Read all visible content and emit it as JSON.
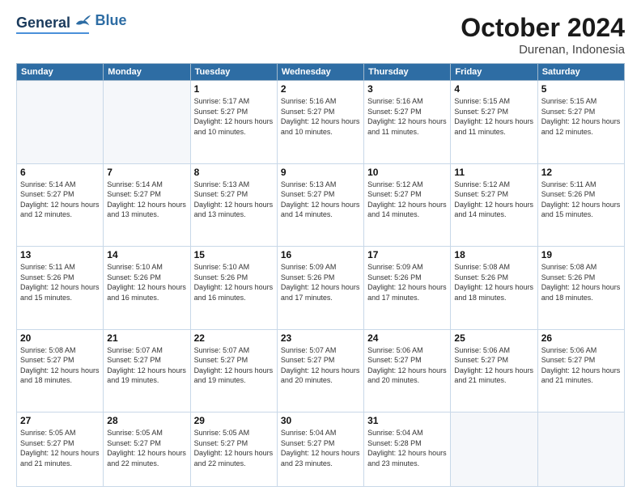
{
  "header": {
    "logo_general": "General",
    "logo_blue": "Blue",
    "month": "October 2024",
    "location": "Durenan, Indonesia"
  },
  "days_of_week": [
    "Sunday",
    "Monday",
    "Tuesday",
    "Wednesday",
    "Thursday",
    "Friday",
    "Saturday"
  ],
  "weeks": [
    [
      {
        "day": "",
        "sunrise": "",
        "sunset": "",
        "daylight": "",
        "empty": true
      },
      {
        "day": "",
        "sunrise": "",
        "sunset": "",
        "daylight": "",
        "empty": true
      },
      {
        "day": "1",
        "sunrise": "Sunrise: 5:17 AM",
        "sunset": "Sunset: 5:27 PM",
        "daylight": "Daylight: 12 hours and 10 minutes."
      },
      {
        "day": "2",
        "sunrise": "Sunrise: 5:16 AM",
        "sunset": "Sunset: 5:27 PM",
        "daylight": "Daylight: 12 hours and 10 minutes."
      },
      {
        "day": "3",
        "sunrise": "Sunrise: 5:16 AM",
        "sunset": "Sunset: 5:27 PM",
        "daylight": "Daylight: 12 hours and 11 minutes."
      },
      {
        "day": "4",
        "sunrise": "Sunrise: 5:15 AM",
        "sunset": "Sunset: 5:27 PM",
        "daylight": "Daylight: 12 hours and 11 minutes."
      },
      {
        "day": "5",
        "sunrise": "Sunrise: 5:15 AM",
        "sunset": "Sunset: 5:27 PM",
        "daylight": "Daylight: 12 hours and 12 minutes."
      }
    ],
    [
      {
        "day": "6",
        "sunrise": "Sunrise: 5:14 AM",
        "sunset": "Sunset: 5:27 PM",
        "daylight": "Daylight: 12 hours and 12 minutes."
      },
      {
        "day": "7",
        "sunrise": "Sunrise: 5:14 AM",
        "sunset": "Sunset: 5:27 PM",
        "daylight": "Daylight: 12 hours and 13 minutes."
      },
      {
        "day": "8",
        "sunrise": "Sunrise: 5:13 AM",
        "sunset": "Sunset: 5:27 PM",
        "daylight": "Daylight: 12 hours and 13 minutes."
      },
      {
        "day": "9",
        "sunrise": "Sunrise: 5:13 AM",
        "sunset": "Sunset: 5:27 PM",
        "daylight": "Daylight: 12 hours and 14 minutes."
      },
      {
        "day": "10",
        "sunrise": "Sunrise: 5:12 AM",
        "sunset": "Sunset: 5:27 PM",
        "daylight": "Daylight: 12 hours and 14 minutes."
      },
      {
        "day": "11",
        "sunrise": "Sunrise: 5:12 AM",
        "sunset": "Sunset: 5:27 PM",
        "daylight": "Daylight: 12 hours and 14 minutes."
      },
      {
        "day": "12",
        "sunrise": "Sunrise: 5:11 AM",
        "sunset": "Sunset: 5:26 PM",
        "daylight": "Daylight: 12 hours and 15 minutes."
      }
    ],
    [
      {
        "day": "13",
        "sunrise": "Sunrise: 5:11 AM",
        "sunset": "Sunset: 5:26 PM",
        "daylight": "Daylight: 12 hours and 15 minutes."
      },
      {
        "day": "14",
        "sunrise": "Sunrise: 5:10 AM",
        "sunset": "Sunset: 5:26 PM",
        "daylight": "Daylight: 12 hours and 16 minutes."
      },
      {
        "day": "15",
        "sunrise": "Sunrise: 5:10 AM",
        "sunset": "Sunset: 5:26 PM",
        "daylight": "Daylight: 12 hours and 16 minutes."
      },
      {
        "day": "16",
        "sunrise": "Sunrise: 5:09 AM",
        "sunset": "Sunset: 5:26 PM",
        "daylight": "Daylight: 12 hours and 17 minutes."
      },
      {
        "day": "17",
        "sunrise": "Sunrise: 5:09 AM",
        "sunset": "Sunset: 5:26 PM",
        "daylight": "Daylight: 12 hours and 17 minutes."
      },
      {
        "day": "18",
        "sunrise": "Sunrise: 5:08 AM",
        "sunset": "Sunset: 5:26 PM",
        "daylight": "Daylight: 12 hours and 18 minutes."
      },
      {
        "day": "19",
        "sunrise": "Sunrise: 5:08 AM",
        "sunset": "Sunset: 5:26 PM",
        "daylight": "Daylight: 12 hours and 18 minutes."
      }
    ],
    [
      {
        "day": "20",
        "sunrise": "Sunrise: 5:08 AM",
        "sunset": "Sunset: 5:27 PM",
        "daylight": "Daylight: 12 hours and 18 minutes."
      },
      {
        "day": "21",
        "sunrise": "Sunrise: 5:07 AM",
        "sunset": "Sunset: 5:27 PM",
        "daylight": "Daylight: 12 hours and 19 minutes."
      },
      {
        "day": "22",
        "sunrise": "Sunrise: 5:07 AM",
        "sunset": "Sunset: 5:27 PM",
        "daylight": "Daylight: 12 hours and 19 minutes."
      },
      {
        "day": "23",
        "sunrise": "Sunrise: 5:07 AM",
        "sunset": "Sunset: 5:27 PM",
        "daylight": "Daylight: 12 hours and 20 minutes."
      },
      {
        "day": "24",
        "sunrise": "Sunrise: 5:06 AM",
        "sunset": "Sunset: 5:27 PM",
        "daylight": "Daylight: 12 hours and 20 minutes."
      },
      {
        "day": "25",
        "sunrise": "Sunrise: 5:06 AM",
        "sunset": "Sunset: 5:27 PM",
        "daylight": "Daylight: 12 hours and 21 minutes."
      },
      {
        "day": "26",
        "sunrise": "Sunrise: 5:06 AM",
        "sunset": "Sunset: 5:27 PM",
        "daylight": "Daylight: 12 hours and 21 minutes."
      }
    ],
    [
      {
        "day": "27",
        "sunrise": "Sunrise: 5:05 AM",
        "sunset": "Sunset: 5:27 PM",
        "daylight": "Daylight: 12 hours and 21 minutes."
      },
      {
        "day": "28",
        "sunrise": "Sunrise: 5:05 AM",
        "sunset": "Sunset: 5:27 PM",
        "daylight": "Daylight: 12 hours and 22 minutes."
      },
      {
        "day": "29",
        "sunrise": "Sunrise: 5:05 AM",
        "sunset": "Sunset: 5:27 PM",
        "daylight": "Daylight: 12 hours and 22 minutes."
      },
      {
        "day": "30",
        "sunrise": "Sunrise: 5:04 AM",
        "sunset": "Sunset: 5:27 PM",
        "daylight": "Daylight: 12 hours and 23 minutes."
      },
      {
        "day": "31",
        "sunrise": "Sunrise: 5:04 AM",
        "sunset": "Sunset: 5:28 PM",
        "daylight": "Daylight: 12 hours and 23 minutes."
      },
      {
        "day": "",
        "sunrise": "",
        "sunset": "",
        "daylight": "",
        "empty": true
      },
      {
        "day": "",
        "sunrise": "",
        "sunset": "",
        "daylight": "",
        "empty": true
      }
    ]
  ]
}
